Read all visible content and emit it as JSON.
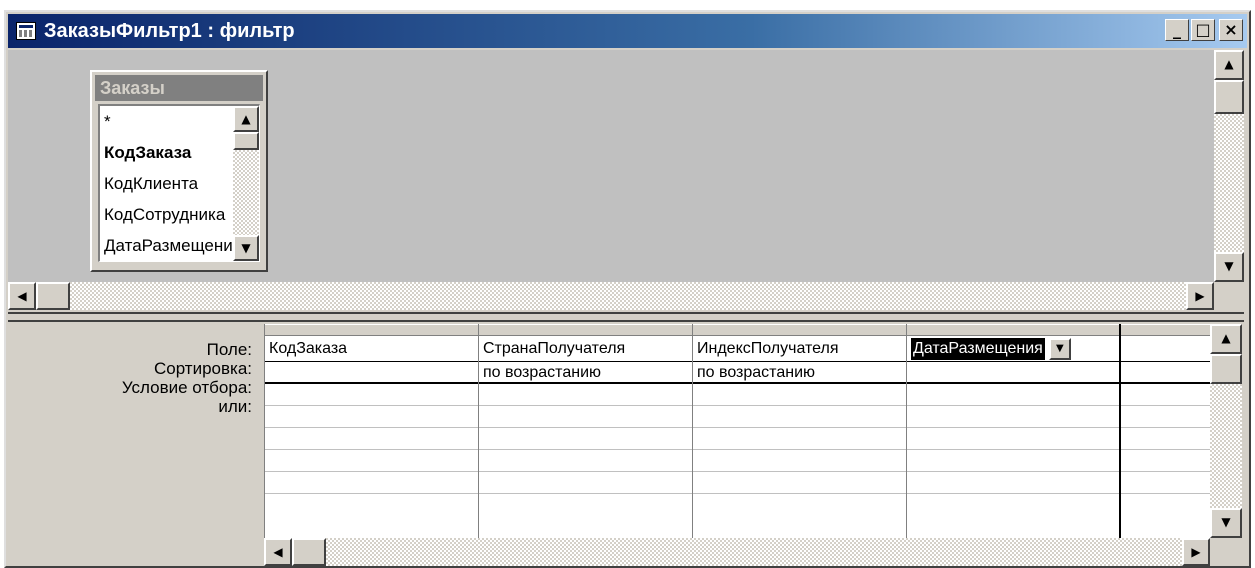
{
  "window": {
    "title": "ЗаказыФильтр1 : фильтр",
    "minimize_label": "_",
    "maximize_label": "□",
    "close_label": "×"
  },
  "field_list": {
    "title": "Заказы",
    "items": [
      {
        "label": "*",
        "bold": false
      },
      {
        "label": "КодЗаказа",
        "bold": true
      },
      {
        "label": "КодКлиента",
        "bold": false
      },
      {
        "label": "КодСотрудника",
        "bold": false
      },
      {
        "label": "ДатаРазмещения",
        "bold": false
      }
    ]
  },
  "grid": {
    "row_labels": {
      "field": "Поле:",
      "sort": "Сортировка:",
      "criteria": "Условие отбора:",
      "or": "или:"
    },
    "columns": [
      {
        "field": "КодЗаказа",
        "sort": ""
      },
      {
        "field": "СтранаПолучателя",
        "sort": "по возрастанию"
      },
      {
        "field": "ИндексПолучателя",
        "sort": "по возрастанию"
      },
      {
        "field": "ДатаРазмещения",
        "sort": ""
      },
      {
        "field": "",
        "sort": ""
      }
    ]
  },
  "icons": {
    "scroll_up": "▲",
    "scroll_down": "▼",
    "scroll_left": "◀",
    "scroll_right": "▶",
    "dropdown": "▼"
  }
}
